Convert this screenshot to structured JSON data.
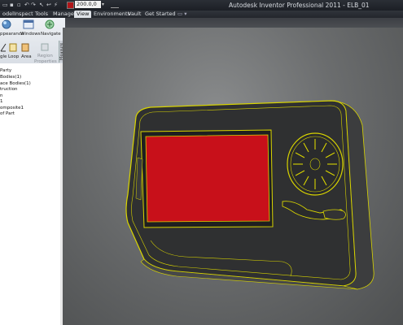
{
  "window": {
    "title": "Autodesk Inventor Professional 2011 -   ELB_01"
  },
  "quick_access": {
    "value": "200.0,0",
    "color": "#b0161a"
  },
  "menu": {
    "items": [
      {
        "id": "model",
        "label": "odel"
      },
      {
        "id": "inspect",
        "label": "Inspect"
      },
      {
        "id": "tools",
        "label": "Tools"
      },
      {
        "id": "manage",
        "label": "Manage"
      },
      {
        "id": "view",
        "label": "View",
        "active": true
      },
      {
        "id": "environments",
        "label": "Environments"
      },
      {
        "id": "vault",
        "label": "Vault"
      },
      {
        "id": "getstarted",
        "label": "Get Started"
      }
    ]
  },
  "ribbon": {
    "appearance": "ppearance",
    "windows": "Windows",
    "navigate": "Navigate",
    "angle": "gle",
    "loop": "Loop",
    "area": "Area",
    "region_props_1": "Region",
    "region_props_2": "Properties",
    "measure_panel": "Measure"
  },
  "browser": {
    "items": [
      "Party",
      "Bodies(1)",
      "ace Bodies(1)",
      "truction",
      "n",
      "1",
      "omposite1",
      "of Part"
    ]
  },
  "colors": {
    "highlight": "#d8d400",
    "screen": "#c8101a",
    "body": "#2f3031"
  }
}
